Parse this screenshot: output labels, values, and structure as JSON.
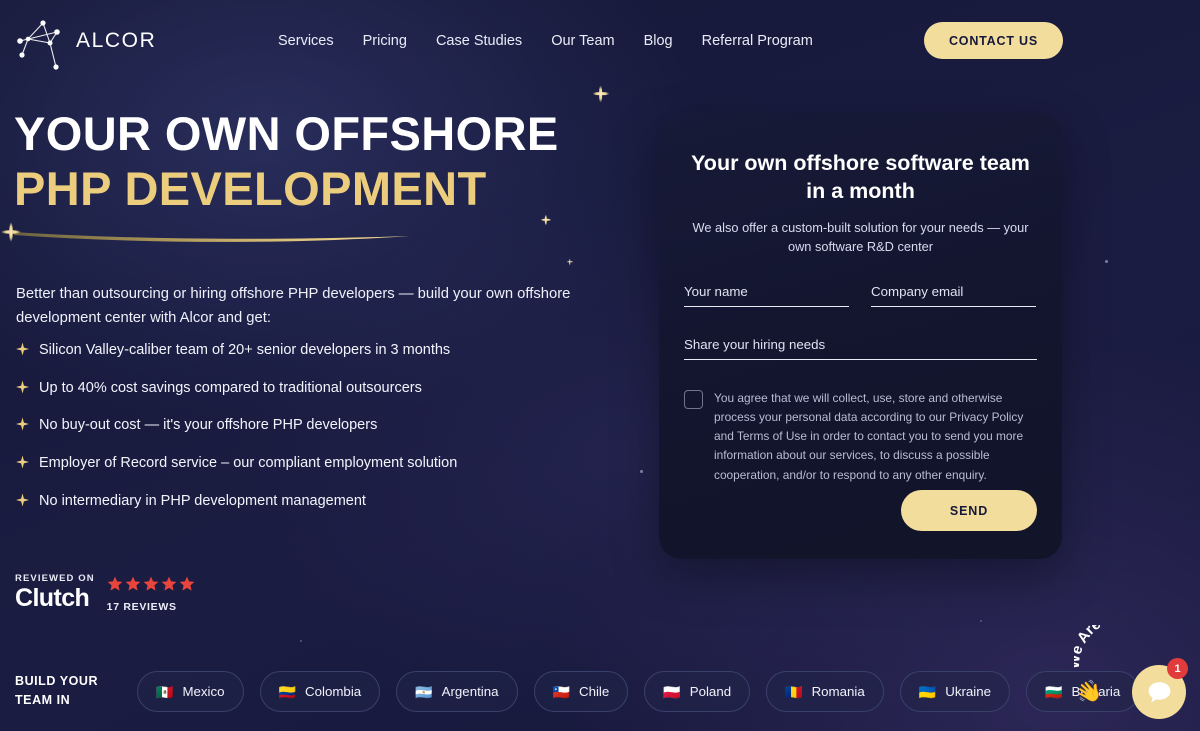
{
  "brand": {
    "name": "ALCOR",
    "logo_icon": "constellation-logo-icon"
  },
  "nav": {
    "items": [
      {
        "label": "Services"
      },
      {
        "label": "Pricing"
      },
      {
        "label": "Case Studies"
      },
      {
        "label": "Our Team"
      },
      {
        "label": "Blog"
      },
      {
        "label": "Referral Program"
      }
    ],
    "cta_label": "CONTACT US"
  },
  "hero": {
    "headline_line1": "YOUR OWN OFFSHORE",
    "headline_line2": "PHP DEVELOPMENT",
    "lead": "Better than outsourcing or hiring offshore PHP developers — build your own offshore development center with Alcor and get:",
    "bullets": [
      "Silicon Valley-caliber team of 20+ senior developers in 3 months",
      "Up to 40% cost savings compared to traditional outsourcers",
      "No buy-out cost — it's your offshore PHP developers",
      "Employer of Record service – our compliant employment solution",
      "No intermediary in PHP development management"
    ]
  },
  "clutch": {
    "reviewed_on": "REVIEWED ON",
    "logo_text": "Clutch",
    "rating_stars": 5,
    "reviews_label": "17 REVIEWS"
  },
  "form": {
    "title": "Your own offshore software team in a month",
    "subtitle": "We also offer a custom-built solution for your needs — your own software R&D center",
    "fields": [
      {
        "name": "your-name",
        "placeholder": "Your name",
        "value": ""
      },
      {
        "name": "company-email",
        "placeholder": "Company email",
        "value": ""
      },
      {
        "name": "hiring-needs",
        "placeholder": "Share your hiring needs",
        "value": ""
      }
    ],
    "consent_text": "You agree that we will collect, use, store and otherwise process your personal data according to our Privacy Policy and Terms of Use in order to contact you to send you more information about our services, to discuss a possible cooperation, and/or to respond to any other enquiry.",
    "consent_checked": false,
    "submit_label": "SEND"
  },
  "countries": {
    "label": "BUILD YOUR TEAM IN",
    "items": [
      {
        "name": "Mexico",
        "flag": "🇲🇽"
      },
      {
        "name": "Colombia",
        "flag": "🇨🇴"
      },
      {
        "name": "Argentina",
        "flag": "🇦🇷"
      },
      {
        "name": "Chile",
        "flag": "🇨🇱"
      },
      {
        "name": "Poland",
        "flag": "🇵🇱"
      },
      {
        "name": "Romania",
        "flag": "🇷🇴"
      },
      {
        "name": "Ukraine",
        "flag": "🇺🇦"
      },
      {
        "name": "Bulgaria",
        "flag": "🇧🇬"
      }
    ]
  },
  "chat": {
    "label": "We Are Here!",
    "hand_icon": "waving-hand-icon",
    "bubble_icon": "chat-bubble-icon",
    "badge_count": "1"
  },
  "colors": {
    "accent_gold": "#f2dd9c",
    "headline_gold": "#eccd7d",
    "background_navy": "#161a3a",
    "card_navy": "#13152e",
    "star_red": "#e8453c",
    "badge_red": "#e23b3b"
  }
}
